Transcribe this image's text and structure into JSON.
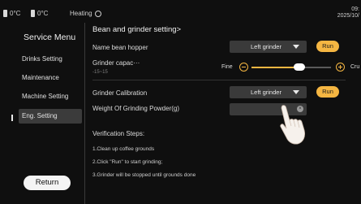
{
  "status": {
    "tank1_temp": "0°C",
    "tank2_temp": "0°C",
    "heating_label": "Heating",
    "time": "09:",
    "date": "2025/10/"
  },
  "sidebar": {
    "title": "Service Menu",
    "items": [
      {
        "label": "Drinks Setting"
      },
      {
        "label": "Maintenance"
      },
      {
        "label": "Machine Setting"
      },
      {
        "label": "Eng. Setting"
      }
    ],
    "active_index": 3,
    "return_label": "Return"
  },
  "main": {
    "page_title": "Bean and grinder setting>",
    "bean_hopper": {
      "label": "Name bean hopper",
      "selected": "Left grinder",
      "run_label": "Run"
    },
    "grinder_capacity": {
      "label": "Grinder capac···",
      "range_hint": "-15~15",
      "fine_label": "Fine",
      "crude_label": "Cru",
      "value": "",
      "position_fraction": 0.6
    },
    "grinder_calibration": {
      "label": "Grinder Calibration",
      "selected": "Left grinder",
      "run_label": "Run"
    },
    "weight": {
      "label": "Weight Of Grinding Powder(g)",
      "value": ""
    },
    "verification": {
      "title": "Verification Steps:",
      "steps": [
        "1.Clean up coffee grounds",
        "2.Click \"Run\" to start grinding;",
        "3.Grinder will be stopped until grounds done"
      ]
    }
  },
  "colors": {
    "accent": "#f5b642",
    "background": "#0f0f0f",
    "control": "#3a3a3a"
  },
  "icons": [
    "tank-icon",
    "heating-icon",
    "chevron-down-icon",
    "minus-icon",
    "plus-icon",
    "clear-icon",
    "pointing-hand-icon"
  ]
}
